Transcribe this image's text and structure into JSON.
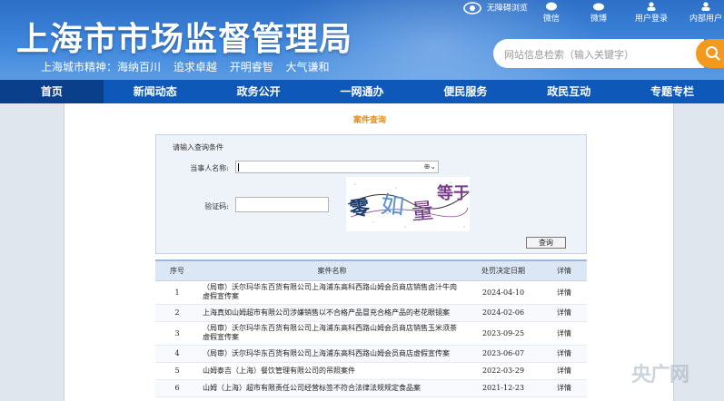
{
  "header": {
    "site_title": "上海市市场监督管理局",
    "slogan": [
      "上海城市精神：海纳百川",
      "追求卓越",
      "开明睿智",
      "大气谦和"
    ],
    "accessibility_label": "无障碍浏览",
    "tools": [
      {
        "label": "微信",
        "icon": "wechat-icon"
      },
      {
        "label": "微博",
        "icon": "weibo-icon"
      },
      {
        "label": "用户登录",
        "icon": "user-icon"
      },
      {
        "label": "内部用户",
        "icon": "user-icon"
      }
    ],
    "search_placeholder": "网站信息检索（输入关键字）"
  },
  "nav": [
    "首页",
    "新闻动态",
    "政务公开",
    "一网通办",
    "便民服务",
    "政民互动",
    "专题专栏"
  ],
  "page_title": "案件查询",
  "query": {
    "heading": "请输入查询条件",
    "party_label": "当事人名称:",
    "captcha_label": "验证码:",
    "captcha_text": "零 如 量 等于",
    "button": "查询"
  },
  "table": {
    "headers": [
      "序号",
      "案件名称",
      "处罚决定日期",
      "详情"
    ],
    "rows": [
      {
        "no": "1",
        "name": "（局审）沃尔玛华东百货有限公司上海浦东高科西路山姆会员商店销售卤汁牛肉虚假宣传案",
        "date": "2024-04-10",
        "detail": "详情"
      },
      {
        "no": "2",
        "name": "上海真如山姆超市有限公司涉嫌销售以不合格产品冒充合格产品的老花眼镜案",
        "date": "2024-02-06",
        "detail": "详情"
      },
      {
        "no": "3",
        "name": "（局审）沃尔玛华东百货有限公司上海浦东高科西路山姆会员商店销售玉米须茶虚假宣传案",
        "date": "2023-09-25",
        "detail": "详情"
      },
      {
        "no": "4",
        "name": "（局审）沃尔玛华东百货有限公司上海浦东高科西路山姆会员商店虚假宣传案",
        "date": "2023-06-07",
        "detail": "详情"
      },
      {
        "no": "5",
        "name": "山姆泰吉（上海）餐饮管理有限公司的吊照案件",
        "date": "2022-03-29",
        "detail": "详情"
      },
      {
        "no": "6",
        "name": "山姆（上海）超市有限责任公司经营标签不符合法律法规规定食品案",
        "date": "2021-12-23",
        "detail": "详情"
      }
    ]
  },
  "watermark": "央广网",
  "colors": {
    "nav": "#0d58b8",
    "nav_active": "#0a3f8c",
    "accent": "#f39a1e",
    "title_orange": "#e58a1a"
  }
}
